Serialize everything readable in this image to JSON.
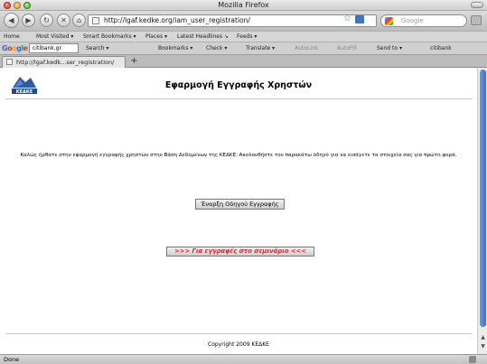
{
  "window": {
    "title": "Mozilla Firefox"
  },
  "nav": {
    "url": "http://lgaf.kedke.org/iam_user_registration/",
    "search_placeholder": "Google"
  },
  "bookmarks_bar": [
    "Home",
    "Most Visited ▾",
    "Smart Bookmarks ▾",
    "Places ▾",
    "Latest Headlines ↘",
    "Feeds ▾"
  ],
  "google_toolbar": {
    "query": "citibank.gr",
    "items": [
      "Search ▾",
      "Bookmarks ▾",
      "Check ▾",
      "Translate ▾",
      "AutoLink",
      "AutoFill",
      "Send to ▾",
      "citibank"
    ]
  },
  "tabs": [
    {
      "label": "http://lgaf.kedk...ser_registration/"
    }
  ],
  "page": {
    "logo_text": "ΚΕΔΚΕ",
    "title": "Εφαρμογή Εγγραφής Χρηστών",
    "welcome": "Καλώς ήρθατε στην εφαρμογή εγγραφής χρηστών στην Βάση Δεδομένων της ΚΕΔΚΕ. Ακολουθήστε τον παρακάτω οδηγό για να εισάγετε τα στοιχεία σας για πρώτη φορά.",
    "wizard_button": "Έναρξη Οδηγού Εγγραφής",
    "seminar_button": ">>> Για εγγραφές στο σεμινάριο <<<",
    "footer": "Copyright 2009 ΚΕΔΚΕ",
    "seminar_color": "#e0262a"
  },
  "status": {
    "text": "Done"
  }
}
